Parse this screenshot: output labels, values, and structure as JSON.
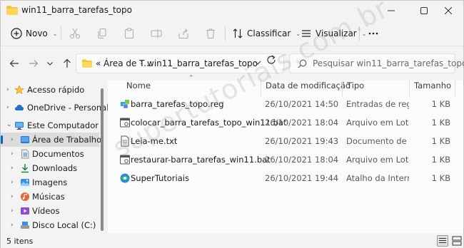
{
  "window": {
    "title": "win11_barra_tarefas_topo"
  },
  "toolbar": {
    "new_label": "Novo",
    "sort_label": "Classificar",
    "view_label": "Visualizar"
  },
  "address": {
    "overflow": "«",
    "crumb1": "Área de T...",
    "crumb2": "win11_barra_tarefas_topo"
  },
  "search": {
    "placeholder": "Pesquisar win11_barra_tarefas_topo"
  },
  "sidebar": {
    "items": [
      {
        "label": "Acesso rápido"
      },
      {
        "label": "OneDrive - Personal"
      },
      {
        "label": "Este Computador"
      },
      {
        "label": "Área de Trabalho"
      },
      {
        "label": "Documentos"
      },
      {
        "label": "Downloads"
      },
      {
        "label": "Imagens"
      },
      {
        "label": "Músicas"
      },
      {
        "label": "Vídeos"
      },
      {
        "label": "Disco Local (C:)"
      }
    ]
  },
  "columns": {
    "name": "Nome",
    "date": "Data de modificação",
    "type": "Tipo",
    "size": "Tamanho"
  },
  "files": [
    {
      "name": "barra_tarefas_topo.reg",
      "date": "26/10/2021 14:50",
      "type": "Entradas de registro",
      "size": "1 KB",
      "icon": "registry-file-icon"
    },
    {
      "name": "colocar_barra_tarefas_topo_win11.bat",
      "date": "26/10/2021 18:04",
      "type": "Arquivo em Lotes ...",
      "size": "1 KB",
      "icon": "batch-file-icon"
    },
    {
      "name": "Leia-me.txt",
      "date": "26/10/2021 19:43",
      "type": "Documento de Te...",
      "size": "1 KB",
      "icon": "text-file-icon"
    },
    {
      "name": "restaurar-barra_tarefas_win11.bat",
      "date": "26/10/2021 18:04",
      "type": "Arquivo em Lotes ...",
      "size": "1 KB",
      "icon": "batch-file-icon"
    },
    {
      "name": "SuperTutoriais",
      "date": "26/10/2021 19:44",
      "type": "Atalho da Internet",
      "size": "1 KB",
      "icon": "internet-shortcut-icon"
    }
  ],
  "status": {
    "count": "5 itens"
  },
  "watermark": "supertutoriais.com.br"
}
